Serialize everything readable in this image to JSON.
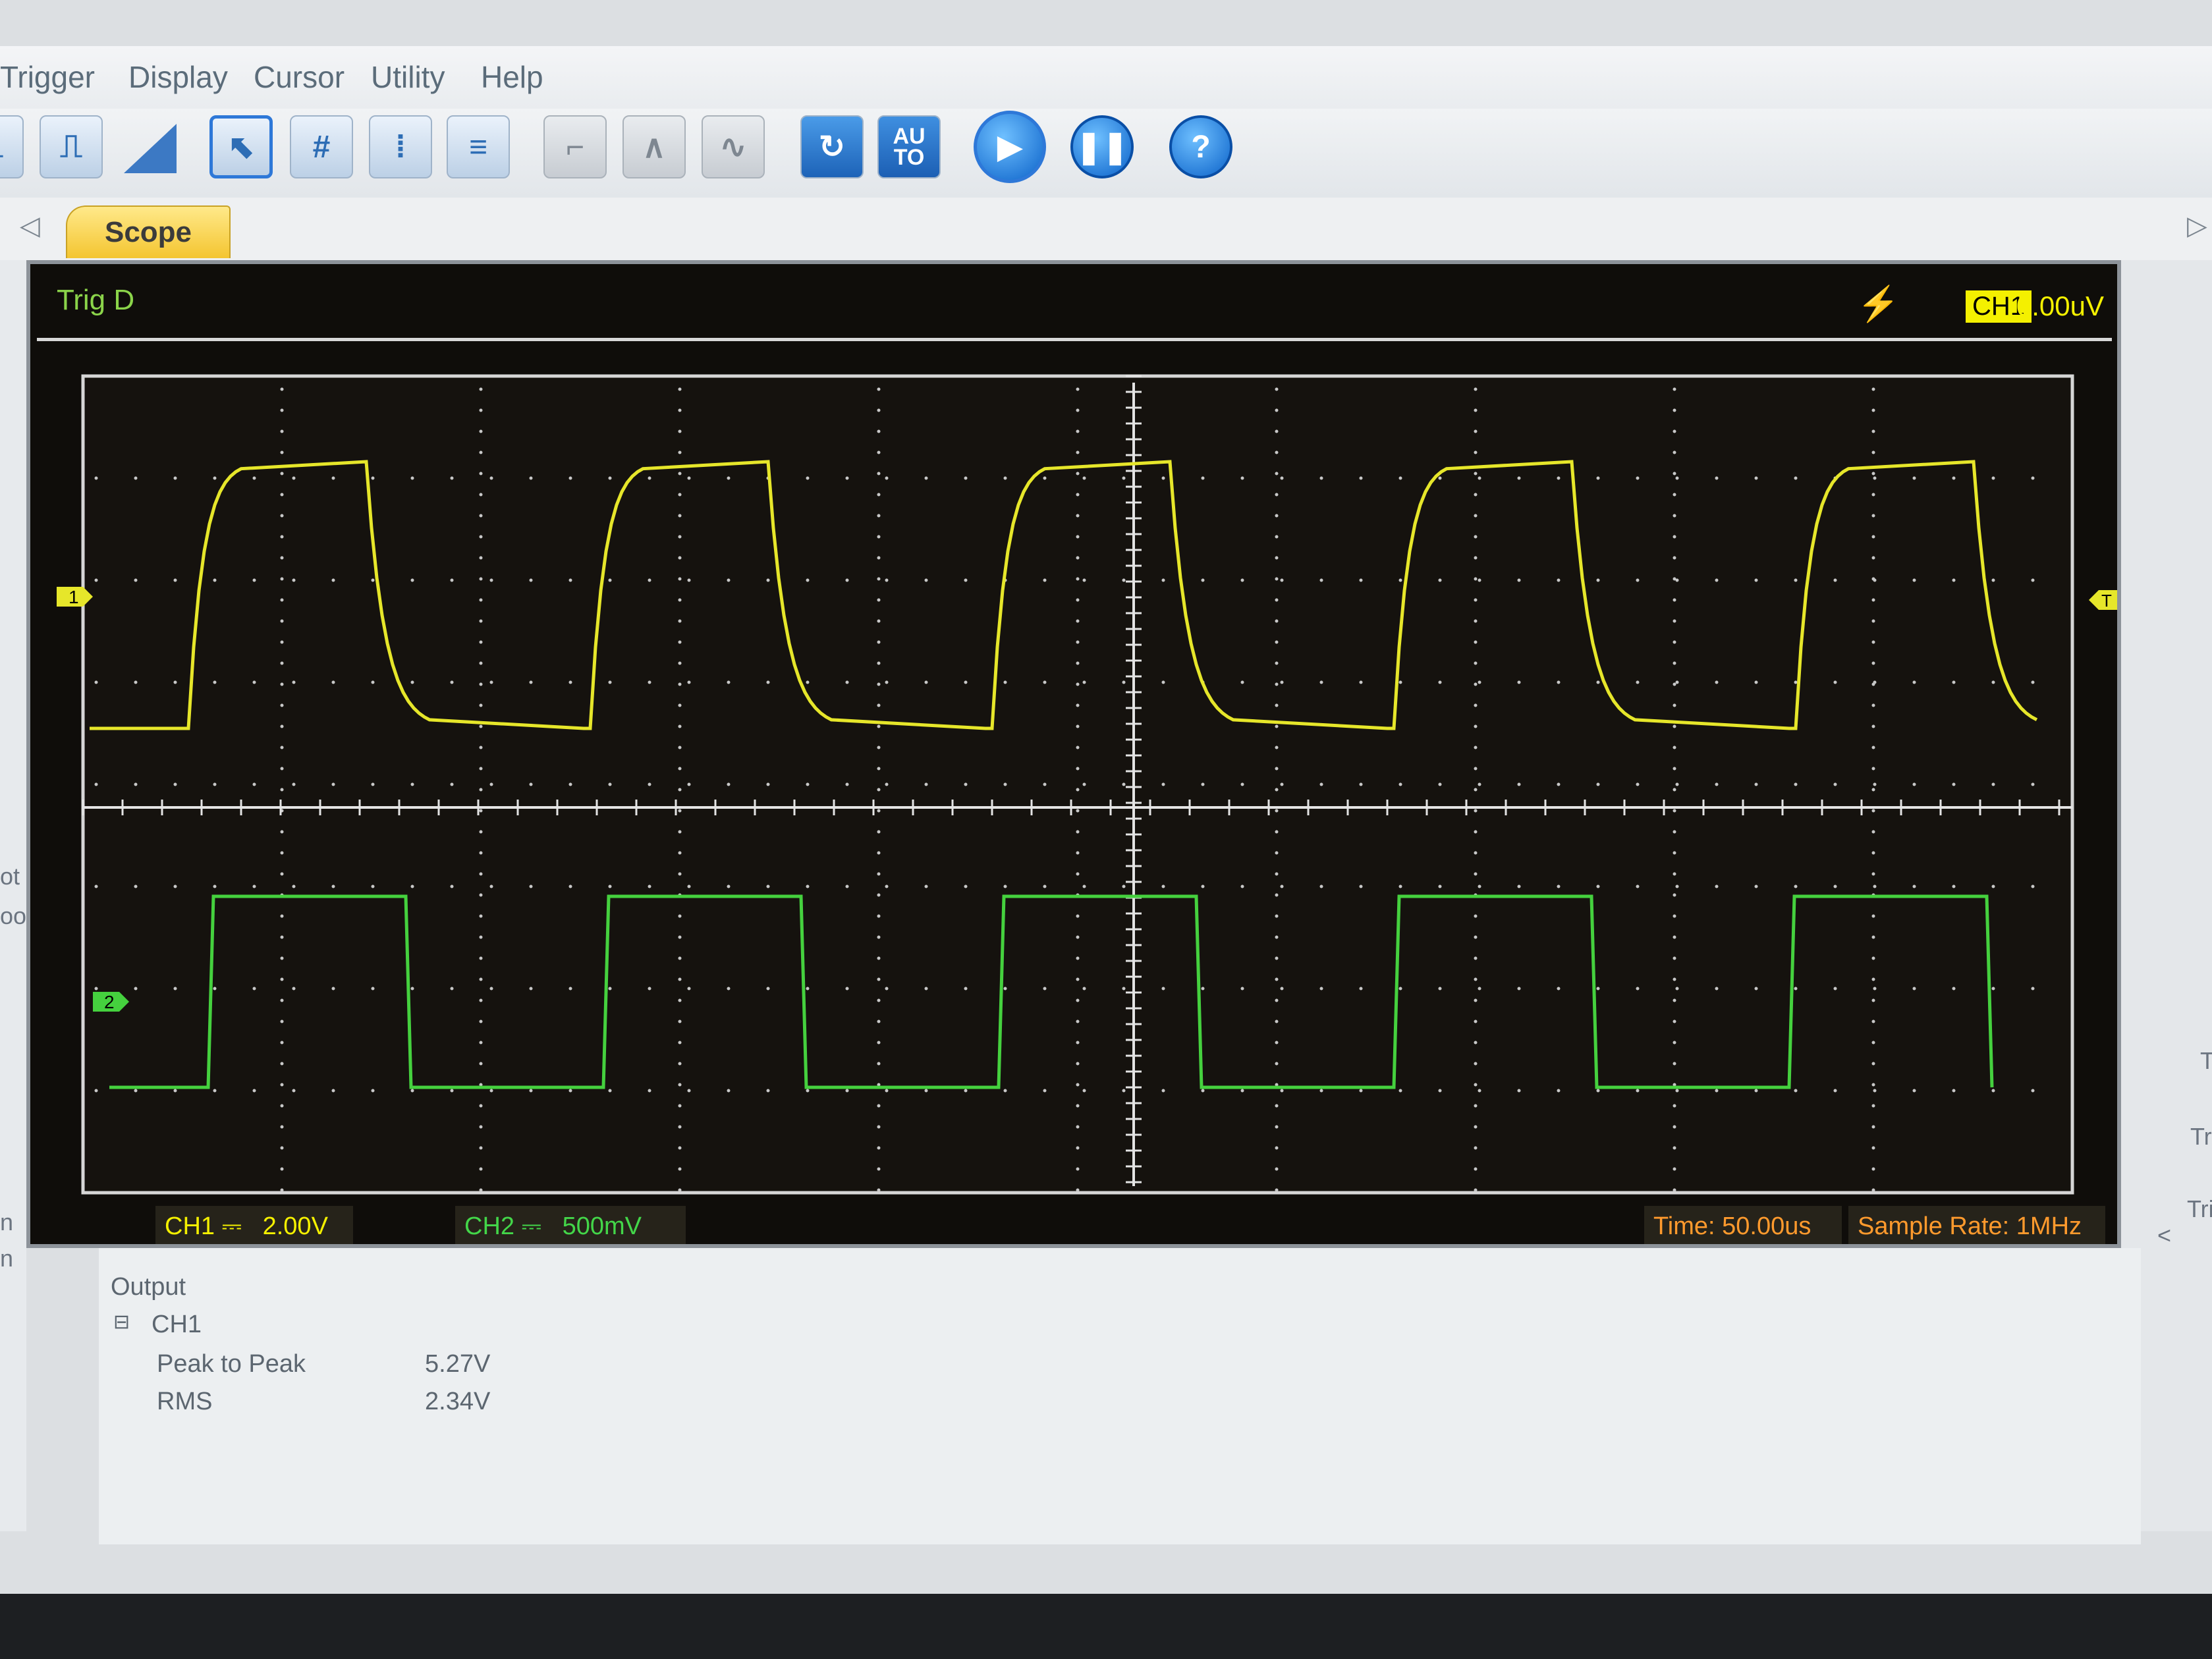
{
  "menu": {
    "items": [
      "Trigger",
      "Display",
      "Cursor",
      "Utility",
      "Help"
    ]
  },
  "toolbar": {
    "icons": [
      "ch1-icon",
      "ch2-icon",
      "ramp-icon",
      "select-icon",
      "grid-icon",
      "cursor-vertical-icon",
      "cursor-horizontal-icon",
      "step-icon",
      "triangle-wave-icon",
      "sine-wave-icon",
      "refresh-icon",
      "auto-icon",
      "run-icon",
      "pause-icon",
      "help-icon"
    ],
    "auto_label": "AU TO",
    "help_label": "?"
  },
  "tabs": {
    "active": "Scope"
  },
  "scope": {
    "trig_status": "Trig D",
    "trigger_channel": "CH1",
    "trigger_level": "0.00uV",
    "ch1_marker": "1",
    "ch2_marker": "2",
    "trigger_marker": "T",
    "ch1_label": "CH1",
    "ch1_scale": "2.00V",
    "ch2_label": "CH2",
    "ch2_scale": "500mV",
    "time_base": "Time: 50.00us",
    "sample_rate": "Sample Rate: 1MHz",
    "coupling_symbol": "⎓",
    "colors": {
      "ch1": "#e6e62a",
      "ch2": "#45d13e",
      "grid": "#d0d0d0",
      "background": "#0f0d0a"
    }
  },
  "output": {
    "title": "Output",
    "channel": "CH1",
    "measurements": [
      {
        "name": "Peak to Peak",
        "value": "5.27V"
      },
      {
        "name": "RMS",
        "value": "2.34V"
      }
    ]
  },
  "edge_fragments": {
    "left": [
      "ot",
      "oot",
      "n",
      "n"
    ],
    "right": [
      "T",
      "Tr",
      "Tri",
      "<"
    ]
  }
}
